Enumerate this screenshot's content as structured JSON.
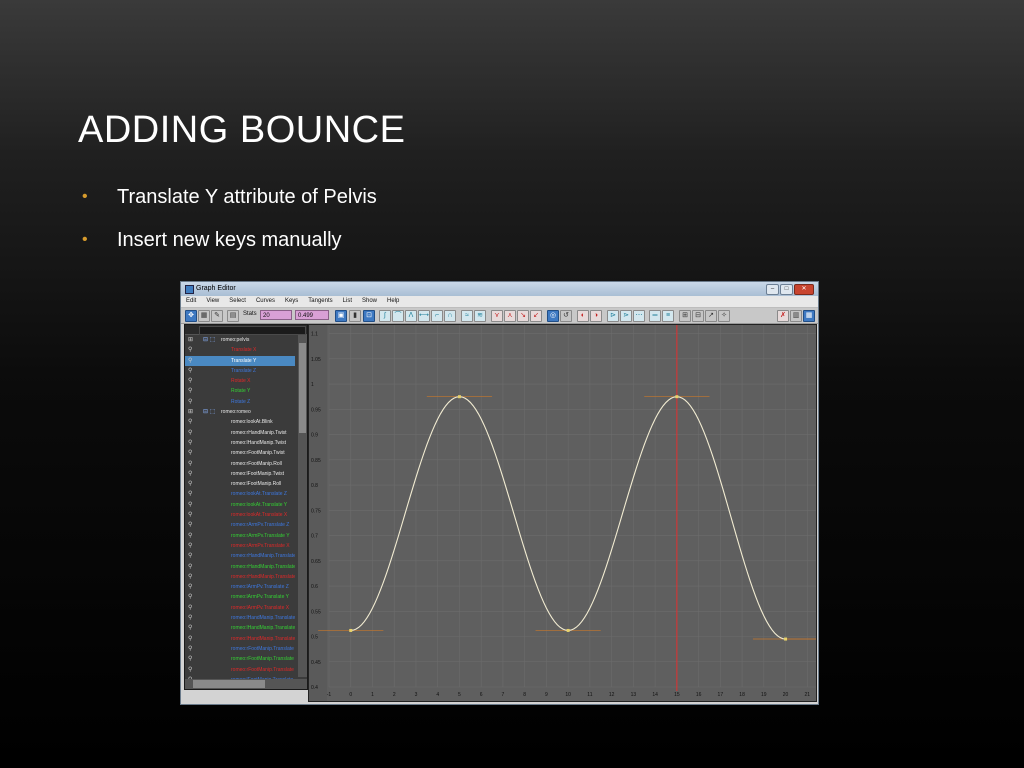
{
  "slide": {
    "title": "ADDING BOUNCE",
    "bullets": [
      "Translate Y attribute of Pelvis",
      "Insert new keys manually"
    ]
  },
  "window": {
    "title": "Graph Editor",
    "menu": [
      "Edit",
      "View",
      "Select",
      "Curves",
      "Keys",
      "Tangents",
      "List",
      "Show",
      "Help"
    ],
    "toolbar": {
      "stats_label": "Stats",
      "stats_frame": "20",
      "stats_value": "0.499"
    }
  },
  "outliner": {
    "items": [
      {
        "label": "romeo:pelvis",
        "color": "#e8e8e8",
        "indent": 36,
        "type": "node"
      },
      {
        "label": "Translate X",
        "color": "#e02828",
        "indent": 46,
        "type": "attr"
      },
      {
        "label": "Translate Y",
        "color": "#ffffff",
        "indent": 46,
        "type": "attr",
        "selected": true
      },
      {
        "label": "Translate Z",
        "color": "#3d78e0",
        "indent": 46,
        "type": "attr"
      },
      {
        "label": "Rotate X",
        "color": "#e02828",
        "indent": 46,
        "type": "attr"
      },
      {
        "label": "Rotate Y",
        "color": "#34d034",
        "indent": 46,
        "type": "attr"
      },
      {
        "label": "Rotate Z",
        "color": "#3d78e0",
        "indent": 46,
        "type": "attr"
      },
      {
        "label": "romeo:romeo",
        "color": "#e8e8e8",
        "indent": 36,
        "type": "node"
      },
      {
        "label": "romeo:lookAt.Blink",
        "color": "#e8e8e8",
        "indent": 46,
        "type": "attr"
      },
      {
        "label": "romeo:rHandManip.Twist",
        "color": "#e8e8e8",
        "indent": 46,
        "type": "attr"
      },
      {
        "label": "romeo:lHandManip.Twist",
        "color": "#e8e8e8",
        "indent": 46,
        "type": "attr"
      },
      {
        "label": "romeo:rFootManip.Twist",
        "color": "#e8e8e8",
        "indent": 46,
        "type": "attr"
      },
      {
        "label": "romeo:rFootManip.Roll",
        "color": "#e8e8e8",
        "indent": 46,
        "type": "attr"
      },
      {
        "label": "romeo:lFootManip.Twist",
        "color": "#e8e8e8",
        "indent": 46,
        "type": "attr"
      },
      {
        "label": "romeo:lFootManip.Roll",
        "color": "#e8e8e8",
        "indent": 46,
        "type": "attr"
      },
      {
        "label": "romeo:lookAt.Translate Z",
        "color": "#3d78e0",
        "indent": 46,
        "type": "attr"
      },
      {
        "label": "romeo:lookAt.Translate Y",
        "color": "#34d034",
        "indent": 46,
        "type": "attr"
      },
      {
        "label": "romeo:lookAt.Translate X",
        "color": "#e02828",
        "indent": 46,
        "type": "attr"
      },
      {
        "label": "romeo:rArmPv.Translate Z",
        "color": "#3d78e0",
        "indent": 46,
        "type": "attr"
      },
      {
        "label": "romeo:rArmPv.Translate Y",
        "color": "#34d034",
        "indent": 46,
        "type": "attr"
      },
      {
        "label": "romeo:rArmPv.Translate X",
        "color": "#e02828",
        "indent": 46,
        "type": "attr"
      },
      {
        "label": "romeo:rHandManip.Translate Z",
        "color": "#3d78e0",
        "indent": 46,
        "type": "attr"
      },
      {
        "label": "romeo:rHandManip.Translate Y",
        "color": "#34d034",
        "indent": 46,
        "type": "attr"
      },
      {
        "label": "romeo:rHandManip.Translate X",
        "color": "#e02828",
        "indent": 46,
        "type": "attr"
      },
      {
        "label": "romeo:lArmPv.Translate Z",
        "color": "#3d78e0",
        "indent": 46,
        "type": "attr"
      },
      {
        "label": "romeo:lArmPv.Translate Y",
        "color": "#34d034",
        "indent": 46,
        "type": "attr"
      },
      {
        "label": "romeo:lArmPv.Translate X",
        "color": "#e02828",
        "indent": 46,
        "type": "attr"
      },
      {
        "label": "romeo:lHandManip.Translate Z",
        "color": "#3d78e0",
        "indent": 46,
        "type": "attr"
      },
      {
        "label": "romeo:lHandManip.Translate Y",
        "color": "#34d034",
        "indent": 46,
        "type": "attr"
      },
      {
        "label": "romeo:lHandManip.Translate X",
        "color": "#e02828",
        "indent": 46,
        "type": "attr"
      },
      {
        "label": "romeo:rFootManip.Translate Z",
        "color": "#3d78e0",
        "indent": 46,
        "type": "attr"
      },
      {
        "label": "romeo:rFootManip.Translate Y",
        "color": "#34d034",
        "indent": 46,
        "type": "attr"
      },
      {
        "label": "romeo:rFootManip.Translate X",
        "color": "#e02828",
        "indent": 46,
        "type": "attr"
      },
      {
        "label": "romeo:lFootManip.Translate Z",
        "color": "#3d78e0",
        "indent": 46,
        "type": "attr"
      }
    ]
  },
  "chart_data": {
    "type": "line",
    "x_ticks": [
      -1,
      0,
      1,
      2,
      3,
      4,
      5,
      6,
      7,
      8,
      9,
      10,
      11,
      12,
      13,
      14,
      15,
      16,
      17,
      18,
      19,
      20,
      21
    ],
    "y_ticks": [
      0.4,
      0.45,
      0.5,
      0.55,
      0.6,
      0.65,
      0.7,
      0.75,
      0.8,
      0.85,
      0.9,
      0.95,
      1,
      1.05,
      1.1
    ],
    "y_tick_labels": [
      "0.4",
      "0.45",
      "0.5",
      "0.55",
      "0.6",
      "0.65",
      "0.7",
      "0.75",
      "0.8",
      "0.85",
      "0.9",
      "0.95",
      "1",
      "1.05",
      "1.1"
    ],
    "xlim": [
      -1,
      21.4
    ],
    "ylim": [
      0.4,
      1.117
    ],
    "current_frame": 15,
    "keys": [
      {
        "x": 0,
        "y": 0.512
      },
      {
        "x": 5,
        "y": 0.975
      },
      {
        "x": 10,
        "y": 0.512
      },
      {
        "x": 15,
        "y": 0.975
      },
      {
        "x": 20,
        "y": 0.495
      }
    ],
    "colors": {
      "curve": "#f2ecd2",
      "key": "#e8d36a",
      "tangent": "#c8772a",
      "time_marker": "#e03030",
      "grid": "#6c6c6c"
    }
  }
}
